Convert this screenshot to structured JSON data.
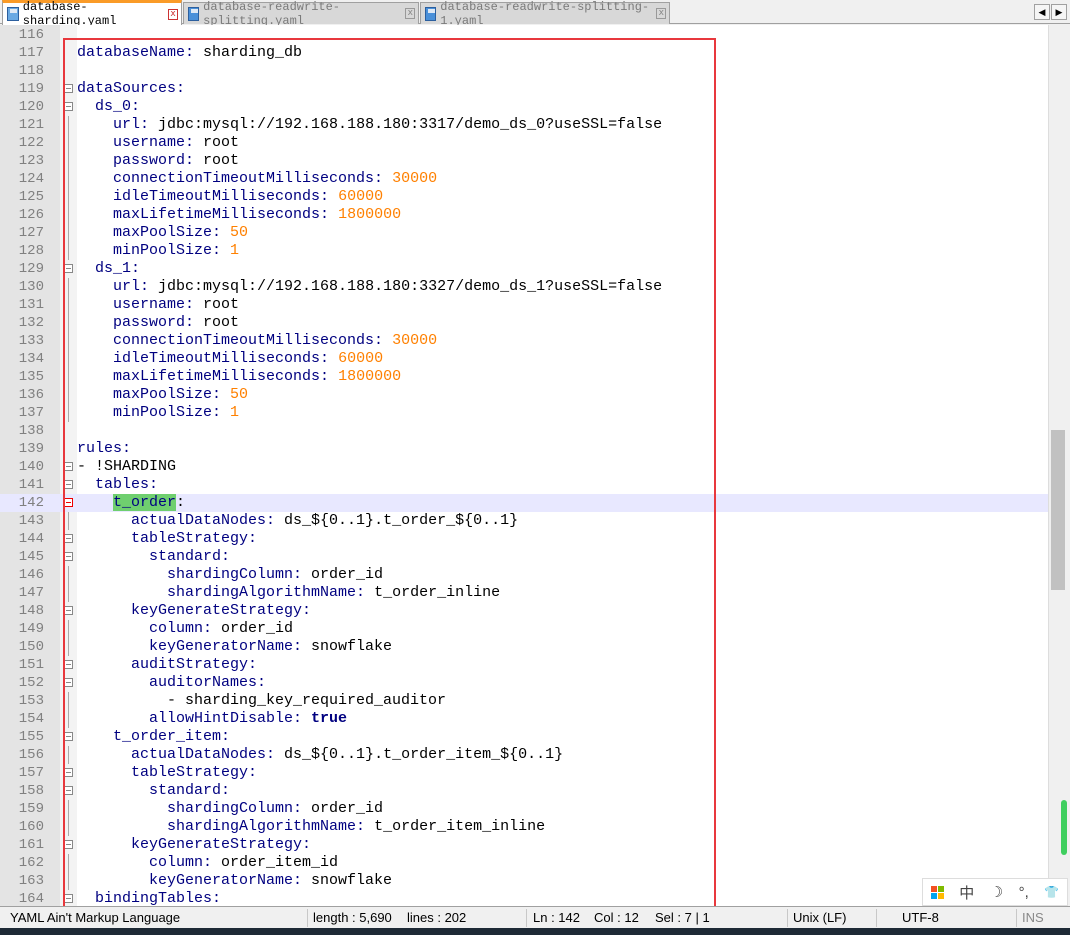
{
  "tabs": [
    {
      "label": "database-sharding.yaml",
      "active": true
    },
    {
      "label": "database-readwrite-splitting.yaml",
      "active": false
    },
    {
      "label": "database-readwrite-splitting-1.yaml",
      "active": false
    }
  ],
  "nav": {
    "left": "◀",
    "right": "▶"
  },
  "editor": {
    "current_line": 142,
    "lines": [
      {
        "n": 116,
        "i": 0,
        "k": "",
        "v": ""
      },
      {
        "n": 117,
        "i": 0,
        "k": "databaseName:",
        "v": " sharding_db",
        "t": "v"
      },
      {
        "n": 118,
        "i": 0,
        "k": "",
        "v": ""
      },
      {
        "n": 119,
        "i": 0,
        "k": "dataSources:",
        "v": "",
        "f": "box"
      },
      {
        "n": 120,
        "i": 2,
        "k": "ds_0:",
        "v": "",
        "f": "box"
      },
      {
        "n": 121,
        "i": 4,
        "k": "url:",
        "v": " jdbc:mysql://192.168.188.180:3317/demo_ds_0?useSSL=false",
        "t": "v",
        "f": "line"
      },
      {
        "n": 122,
        "i": 4,
        "k": "username:",
        "v": " root",
        "t": "v",
        "f": "line"
      },
      {
        "n": 123,
        "i": 4,
        "k": "password:",
        "v": " root",
        "t": "v",
        "f": "line"
      },
      {
        "n": 124,
        "i": 4,
        "k": "connectionTimeoutMilliseconds:",
        "v": " 30000",
        "t": "n",
        "f": "line"
      },
      {
        "n": 125,
        "i": 4,
        "k": "idleTimeoutMilliseconds:",
        "v": " 60000",
        "t": "n",
        "f": "line"
      },
      {
        "n": 126,
        "i": 4,
        "k": "maxLifetimeMilliseconds:",
        "v": " 1800000",
        "t": "n",
        "f": "line"
      },
      {
        "n": 127,
        "i": 4,
        "k": "maxPoolSize:",
        "v": " 50",
        "t": "n",
        "f": "line"
      },
      {
        "n": 128,
        "i": 4,
        "k": "minPoolSize:",
        "v": " 1",
        "t": "n",
        "f": "line"
      },
      {
        "n": 129,
        "i": 2,
        "k": "ds_1:",
        "v": "",
        "f": "box"
      },
      {
        "n": 130,
        "i": 4,
        "k": "url:",
        "v": " jdbc:mysql://192.168.188.180:3327/demo_ds_1?useSSL=false",
        "t": "v",
        "f": "line"
      },
      {
        "n": 131,
        "i": 4,
        "k": "username:",
        "v": " root",
        "t": "v",
        "f": "line"
      },
      {
        "n": 132,
        "i": 4,
        "k": "password:",
        "v": " root",
        "t": "v",
        "f": "line"
      },
      {
        "n": 133,
        "i": 4,
        "k": "connectionTimeoutMilliseconds:",
        "v": " 30000",
        "t": "n",
        "f": "line"
      },
      {
        "n": 134,
        "i": 4,
        "k": "idleTimeoutMilliseconds:",
        "v": " 60000",
        "t": "n",
        "f": "line"
      },
      {
        "n": 135,
        "i": 4,
        "k": "maxLifetimeMilliseconds:",
        "v": " 1800000",
        "t": "n",
        "f": "line"
      },
      {
        "n": 136,
        "i": 4,
        "k": "maxPoolSize:",
        "v": " 50",
        "t": "n",
        "f": "line"
      },
      {
        "n": 137,
        "i": 4,
        "k": "minPoolSize:",
        "v": " 1",
        "t": "n",
        "f": "line"
      },
      {
        "n": 138,
        "i": 0,
        "k": "",
        "v": ""
      },
      {
        "n": 139,
        "i": 0,
        "k": "rules:",
        "v": ""
      },
      {
        "n": 140,
        "i": 0,
        "k": "- !SHARDING",
        "v": "",
        "t": "v",
        "plain": true,
        "f": "box"
      },
      {
        "n": 141,
        "i": 2,
        "k": "tables:",
        "v": "",
        "f": "box"
      },
      {
        "n": 142,
        "i": 4,
        "k": "t_order",
        "v": ":",
        "t": "v",
        "hl": true,
        "f": "red"
      },
      {
        "n": 143,
        "i": 6,
        "k": "actualDataNodes:",
        "v": " ds_${0..1}.t_order_${0..1}",
        "t": "v",
        "f": "line"
      },
      {
        "n": 144,
        "i": 6,
        "k": "tableStrategy:",
        "v": "",
        "f": "box"
      },
      {
        "n": 145,
        "i": 8,
        "k": "standard:",
        "v": "",
        "f": "box"
      },
      {
        "n": 146,
        "i": 10,
        "k": "shardingColumn:",
        "v": " order_id",
        "t": "v",
        "f": "line"
      },
      {
        "n": 147,
        "i": 10,
        "k": "shardingAlgorithmName:",
        "v": " t_order_inline",
        "t": "v",
        "f": "line"
      },
      {
        "n": 148,
        "i": 6,
        "k": "keyGenerateStrategy:",
        "v": "",
        "f": "box"
      },
      {
        "n": 149,
        "i": 8,
        "k": "column:",
        "v": " order_id",
        "t": "v",
        "f": "line"
      },
      {
        "n": 150,
        "i": 8,
        "k": "keyGeneratorName:",
        "v": " snowflake",
        "t": "v",
        "f": "line"
      },
      {
        "n": 151,
        "i": 6,
        "k": "auditStrategy:",
        "v": "",
        "f": "box"
      },
      {
        "n": 152,
        "i": 8,
        "k": "auditorNames:",
        "v": "",
        "f": "box"
      },
      {
        "n": 153,
        "i": 10,
        "k": "- sharding_key_required_auditor",
        "v": "",
        "plain": true,
        "f": "line"
      },
      {
        "n": 154,
        "i": 8,
        "k": "allowHintDisable:",
        "v": " true",
        "t": "b",
        "f": "line"
      },
      {
        "n": 155,
        "i": 4,
        "k": "t_order_item:",
        "v": "",
        "f": "box"
      },
      {
        "n": 156,
        "i": 6,
        "k": "actualDataNodes:",
        "v": " ds_${0..1}.t_order_item_${0..1}",
        "t": "v",
        "f": "line"
      },
      {
        "n": 157,
        "i": 6,
        "k": "tableStrategy:",
        "v": "",
        "f": "box"
      },
      {
        "n": 158,
        "i": 8,
        "k": "standard:",
        "v": "",
        "f": "box"
      },
      {
        "n": 159,
        "i": 10,
        "k": "shardingColumn:",
        "v": " order_id",
        "t": "v",
        "f": "line"
      },
      {
        "n": 160,
        "i": 10,
        "k": "shardingAlgorithmName:",
        "v": " t_order_item_inline",
        "t": "v",
        "f": "line"
      },
      {
        "n": 161,
        "i": 6,
        "k": "keyGenerateStrategy:",
        "v": "",
        "f": "box"
      },
      {
        "n": 162,
        "i": 8,
        "k": "column:",
        "v": " order_item_id",
        "t": "v",
        "f": "line"
      },
      {
        "n": 163,
        "i": 8,
        "k": "keyGeneratorName:",
        "v": " snowflake",
        "t": "v",
        "f": "line"
      },
      {
        "n": 164,
        "i": 2,
        "k": "bindingTables:",
        "v": "",
        "f": "box"
      }
    ]
  },
  "status": {
    "language": "YAML Ain't Markup Language",
    "length": "length : 5,690",
    "lines": "lines : 202",
    "ln": "Ln : 142",
    "col": "Col : 12",
    "sel": "Sel : 7 | 1",
    "eol": "Unix (LF)",
    "encoding": "UTF-8",
    "mode": "INS"
  },
  "ime": {
    "lang": "中",
    "moon": "☽",
    "punct": "°,",
    "shirt": "👕"
  },
  "colors": {
    "key": "#000080",
    "number": "#ff8000",
    "highlight": "#6fcf6f",
    "annotation_box": "#e8383d",
    "tab_accent": "#fa9b28"
  }
}
